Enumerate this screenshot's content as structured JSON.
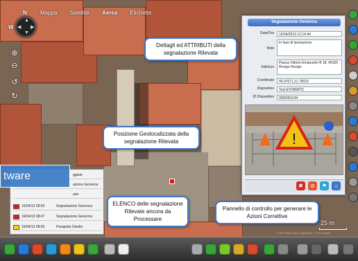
{
  "map": {
    "types": [
      "Mappa",
      "Satellite",
      "Aerea",
      "Etichette"
    ],
    "active_type": "Aerea",
    "scale": "25 m",
    "copyright": "© 2013 Microsoft Corporation © 2013 Nokia"
  },
  "compass": {
    "north": "N",
    "west": "W"
  },
  "callouts": {
    "attributes": "Dettagli ed ATTRIBUTI della segnalazione Rilevata",
    "position": "Posizione Geolocalizzata della segnalazione Rilevata",
    "list": "ELENCO delle segnalazione Rilevate ancora da Processare",
    "control": "Pannello di controllo per generare le Azioni Correttive"
  },
  "software_label": "tware",
  "detail_panel": {
    "title": "Segnalazione Generica",
    "fields": [
      {
        "label": "Data/Ora",
        "value": "16/04/2013 12:14:44"
      },
      {
        "label": "Note",
        "value": "In fase di lavorazione"
      },
      {
        "label": "Indirizzo",
        "value": "Piazza Vittorio Emanuele III 18, 45100 Rovigo Rovigo"
      },
      {
        "label": "Coordinate",
        "value": "45.07071,11.79015"
      },
      {
        "label": "Dispositivo",
        "value": "Test EVOMATIC"
      },
      {
        "label": "ID Dispositivo",
        "value": "0000001144"
      }
    ]
  },
  "list_panel": {
    "rows": [
      {
        "label": "ggiato",
        "color": "#dddddd"
      },
      {
        "label": "azione Generica",
        "color": "#dddddd"
      },
      {
        "label": "uire",
        "color": "#dddddd"
      },
      {
        "time": "16/04/13 08:50",
        "label": "Segnalazione Generica",
        "color": "#d81e1e"
      },
      {
        "time": "16/04/13 08:47",
        "label": "Segnalazione Generica",
        "color": "#d81e1e"
      },
      {
        "time": "16/04/13 08:06",
        "label": "Parapetto Divelto",
        "color": "#f2d21a"
      }
    ]
  },
  "colors": {
    "accent": "#3a78c8",
    "panel_title": "#3b6cc4",
    "software_label_bg": "#3f7fc7"
  }
}
